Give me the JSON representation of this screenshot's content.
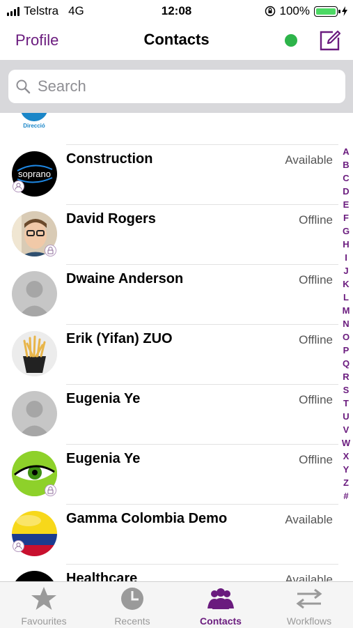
{
  "status_bar": {
    "carrier": "Telstra",
    "network": "4G",
    "time": "12:08",
    "battery": "100%"
  },
  "nav": {
    "left": "Profile",
    "title": "Contacts"
  },
  "search": {
    "placeholder": "Search"
  },
  "partial_item": {
    "label": "Direcció"
  },
  "contacts": [
    {
      "name": "Construction",
      "status": "Available"
    },
    {
      "name": "David Rogers",
      "status": "Offline"
    },
    {
      "name": "Dwaine Anderson",
      "status": "Offline"
    },
    {
      "name": "Erik (Yifan) ZUO",
      "status": "Offline"
    },
    {
      "name": "Eugenia Ye",
      "status": "Offline"
    },
    {
      "name": "Eugenia Ye",
      "status": "Offline"
    },
    {
      "name": "Gamma Colombia Demo",
      "status": "Available"
    },
    {
      "name": "Healthcare",
      "status": "Available"
    }
  ],
  "avatar_label": "soprano",
  "index": [
    "A",
    "B",
    "C",
    "D",
    "E",
    "F",
    "G",
    "H",
    "I",
    "J",
    "K",
    "L",
    "M",
    "N",
    "O",
    "P",
    "Q",
    "R",
    "S",
    "T",
    "U",
    "V",
    "W",
    "X",
    "Y",
    "Z",
    "#"
  ],
  "tabs": [
    {
      "label": "Favourites",
      "icon": "star-icon"
    },
    {
      "label": "Recents",
      "icon": "clock-icon"
    },
    {
      "label": "Contacts",
      "icon": "people-icon"
    },
    {
      "label": "Workflows",
      "icon": "arrows-icon"
    }
  ],
  "colors": {
    "accent": "#6a1b7e",
    "presence": "#2db44a"
  }
}
